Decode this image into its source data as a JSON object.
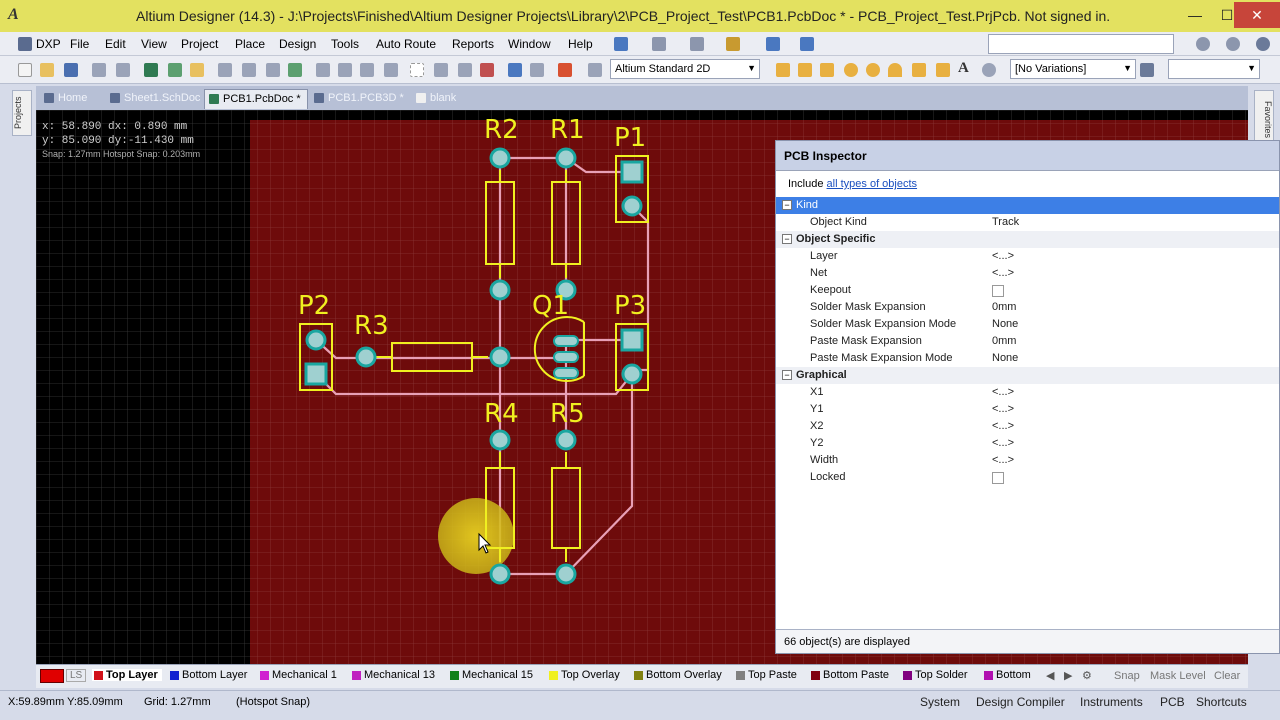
{
  "window": {
    "title": "Altium Designer (14.3) - J:\\Projects\\Finished\\Altium Designer Projects\\Library\\2\\PCB_Project_Test\\PCB1.PcbDoc * - PCB_Project_Test.PrjPcb. Not signed in.",
    "app_icon": "A",
    "minimize": "—",
    "maximize": "☐",
    "close": "✕"
  },
  "menu": [
    "DXP",
    "File",
    "Edit",
    "View",
    "Project",
    "Place",
    "Design",
    "Tools",
    "Auto Route",
    "Reports",
    "Window",
    "Help"
  ],
  "toolbar": {
    "view_mode": "Altium Standard 2D",
    "variations": "[No Variations]"
  },
  "side_panels": {
    "left": "Projects",
    "right": "Favorites"
  },
  "doc_tabs": [
    {
      "label": "Home",
      "active": false
    },
    {
      "label": "Sheet1.SchDoc",
      "active": false
    },
    {
      "label": "PCB1.PcbDoc *",
      "active": true
    },
    {
      "label": "PCB1.PCB3D *",
      "active": false
    },
    {
      "label": "blank",
      "active": false
    }
  ],
  "hud": {
    "line1": "x: 58.890   dx:  0.890  mm",
    "line2": "y: 85.090   dy:-11.430  mm",
    "line3": "Snap: 1.27mm Hotspot Snap: 0.203mm"
  },
  "designators": {
    "r2": "R2",
    "r1": "R1",
    "p1": "P1",
    "p2": "P2",
    "r3": "R3",
    "q1": "Q1",
    "p3": "P3",
    "r4": "R4",
    "r5": "R5"
  },
  "inspector": {
    "title": "PCB Inspector",
    "include_prefix": "Include",
    "include_link": "all types of objects",
    "sections": [
      {
        "name": "Kind",
        "selected": true,
        "rows": [
          {
            "label": "Object Kind",
            "value": "Track",
            "type": "text"
          }
        ]
      },
      {
        "name": "Object Specific",
        "selected": false,
        "rows": [
          {
            "label": "Layer",
            "value": "<...>",
            "type": "text"
          },
          {
            "label": "Net",
            "value": "<...>",
            "type": "text"
          },
          {
            "label": "Keepout",
            "value": "",
            "type": "checkbox"
          },
          {
            "label": "Solder Mask Expansion",
            "value": "0mm",
            "type": "text"
          },
          {
            "label": "Solder Mask Expansion Mode",
            "value": "None",
            "type": "text"
          },
          {
            "label": "Paste Mask Expansion",
            "value": "0mm",
            "type": "text"
          },
          {
            "label": "Paste Mask Expansion Mode",
            "value": "None",
            "type": "text"
          }
        ]
      },
      {
        "name": "Graphical",
        "selected": false,
        "rows": [
          {
            "label": "X1",
            "value": "<...>",
            "type": "text"
          },
          {
            "label": "Y1",
            "value": "<...>",
            "type": "text"
          },
          {
            "label": "X2",
            "value": "<...>",
            "type": "text"
          },
          {
            "label": "Y2",
            "value": "<...>",
            "type": "text"
          },
          {
            "label": "Width",
            "value": "<...>",
            "type": "text"
          },
          {
            "label": "Locked",
            "value": "",
            "type": "checkbox"
          }
        ]
      }
    ],
    "footer": "66 object(s) are displayed"
  },
  "layer_tabs": {
    "current_set": "LS",
    "layers": [
      {
        "label": "Top Layer",
        "color": "#d1111a",
        "active": true
      },
      {
        "label": "Bottom Layer",
        "color": "#1020d0",
        "active": false
      },
      {
        "label": "Mechanical 1",
        "color": "#d020d0",
        "active": false
      },
      {
        "label": "Mechanical 13",
        "color": "#c020c0",
        "active": false
      },
      {
        "label": "Mechanical 15",
        "color": "#10801a",
        "active": false
      },
      {
        "label": "Top Overlay",
        "color": "#f0f020",
        "active": false
      },
      {
        "label": "Bottom Overlay",
        "color": "#808010",
        "active": false
      },
      {
        "label": "Top Paste",
        "color": "#808080",
        "active": false
      },
      {
        "label": "Bottom Paste",
        "color": "#800010",
        "active": false
      },
      {
        "label": "Top Solder",
        "color": "#800080",
        "active": false
      },
      {
        "label": "Bottom",
        "color": "#b010b0",
        "active": false
      }
    ],
    "snap": "Snap",
    "mask_level": "Mask Level",
    "clear": "Clear"
  },
  "status": {
    "coords": "X:59.89mm Y:85.09mm",
    "grid": "Grid: 1.27mm",
    "snap": "(Hotspot Snap)",
    "buttons": [
      "System",
      "Design Compiler",
      "Instruments",
      "PCB",
      "Shortcuts"
    ]
  },
  "colors": {
    "board": "#6e0b0b",
    "track": "#e8a0b6",
    "overlay": "#f0f020",
    "pad": "#9fd0d0",
    "via_ring": "#1aa6a0",
    "cursor_highlight": "#d8c21a"
  }
}
